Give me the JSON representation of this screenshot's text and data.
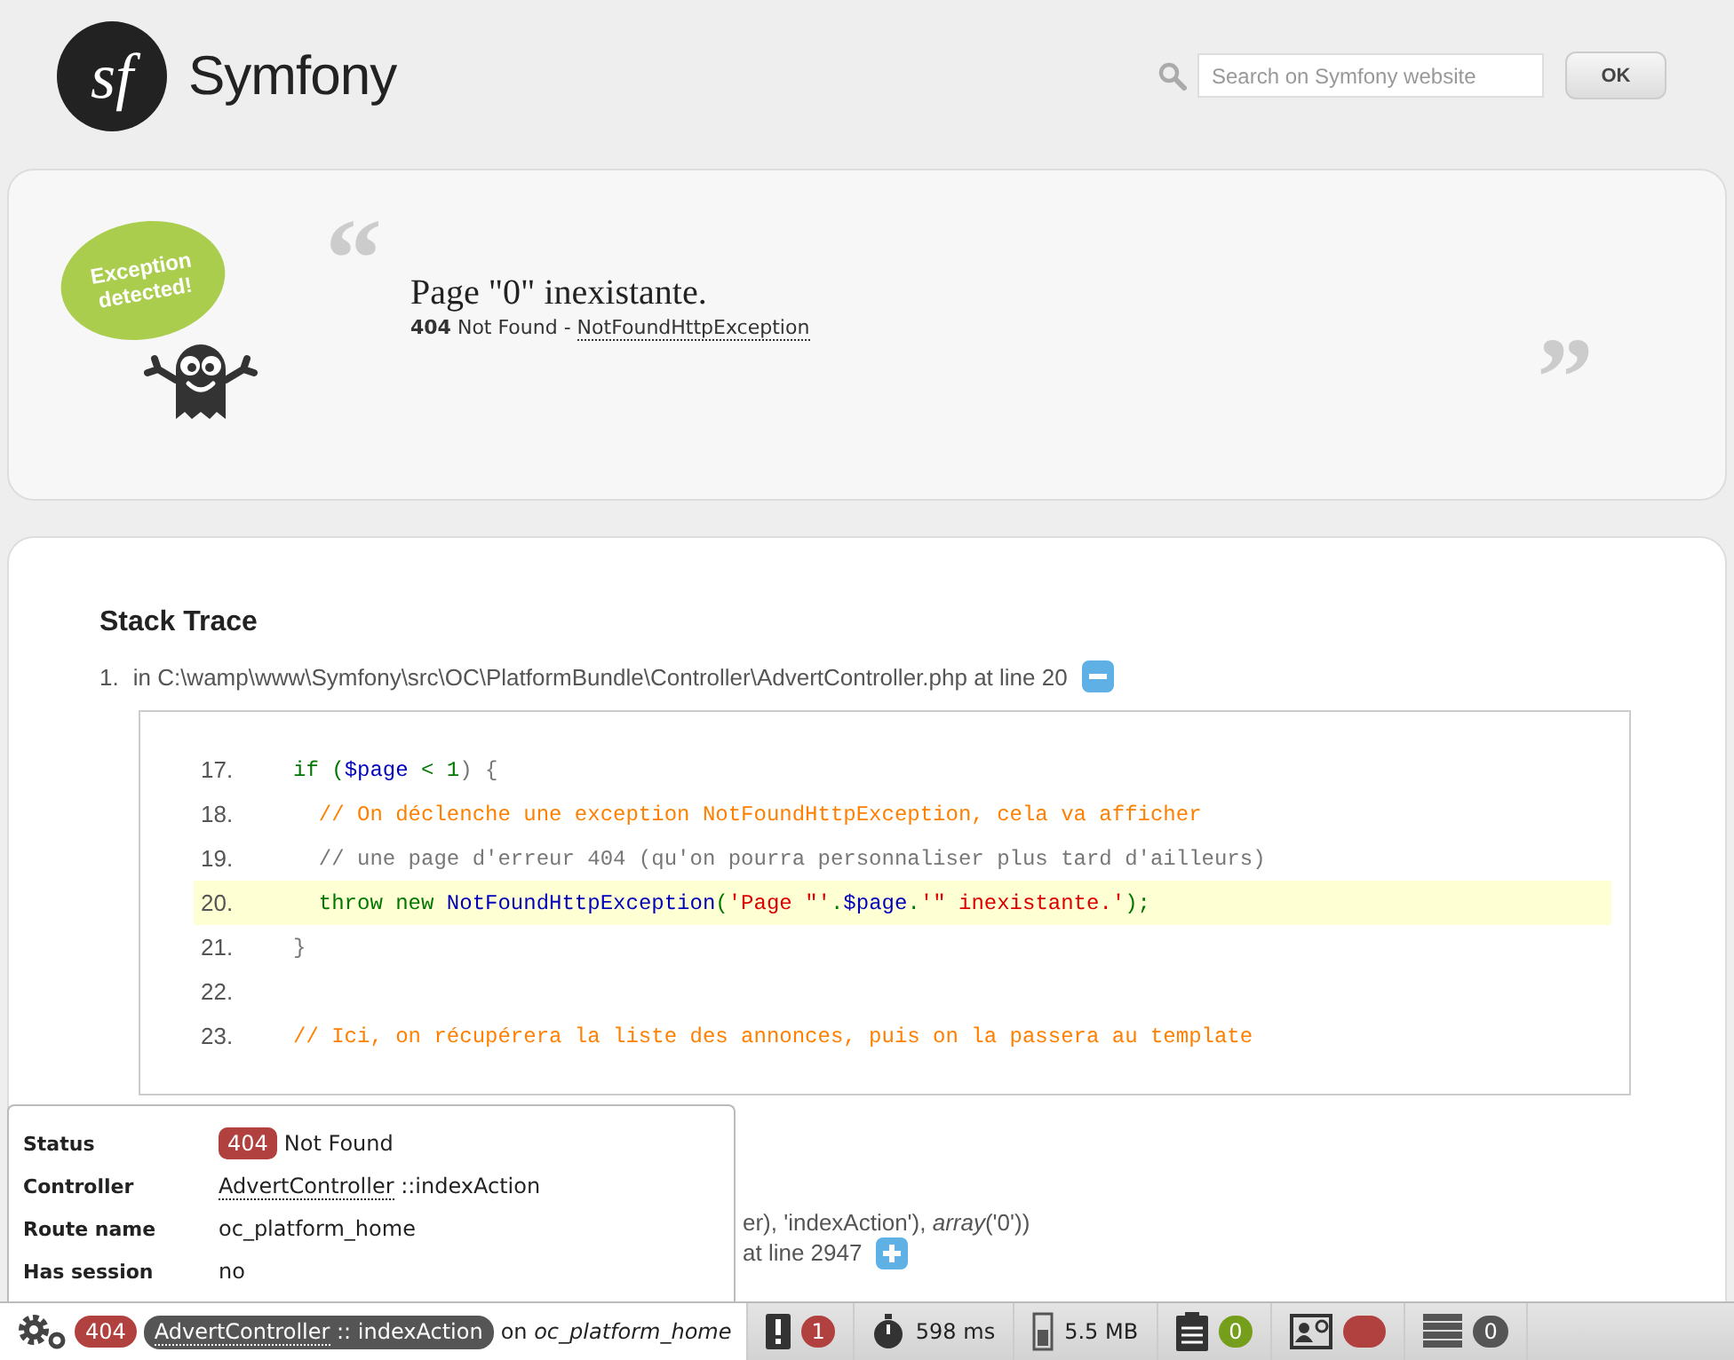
{
  "header": {
    "logo_mark": "sf",
    "brand": "Symfony",
    "search": {
      "placeholder": "Search on Symfony website"
    },
    "ok_button": "OK"
  },
  "exception": {
    "bubble_text": "Exception detected!",
    "open_quote": "“",
    "close_quote": "”",
    "message": "Page \"0\" inexistante.",
    "status_code": "404",
    "status_text": "Not Found - ",
    "exception_class": "NotFoundHttpException"
  },
  "stack_trace": {
    "title": "Stack Trace",
    "items": [
      {
        "number": "1.",
        "location": "in C:\\wamp\\www\\Symfony\\src\\OC\\PlatformBundle\\Controller\\AdvertController.php at line 20",
        "expanded": true,
        "code": [
          {
            "number": "17.",
            "highlighted": false,
            "segments": [
              {
                "kind": "keyword",
                "text": "if ("
              },
              {
                "kind": "variable",
                "text": "$page"
              },
              {
                "kind": "keyword",
                "text": " < 1"
              },
              {
                "kind": "plain",
                "text": ") {"
              }
            ]
          },
          {
            "number": "18.",
            "highlighted": false,
            "segments": [
              {
                "kind": "comment",
                "text": "  // On déclenche une exception NotFoundHttpException, cela va afficher"
              }
            ]
          },
          {
            "number": "19.",
            "highlighted": false,
            "segments": [
              {
                "kind": "plain",
                "text": "  // une page d'erreur 404 (qu'on pourra personnaliser plus tard d'ailleurs)"
              }
            ]
          },
          {
            "number": "20.",
            "highlighted": true,
            "segments": [
              {
                "kind": "keyword",
                "text": "  throw new "
              },
              {
                "kind": "variable",
                "text": "NotFoundHttpException"
              },
              {
                "kind": "keyword",
                "text": "("
              },
              {
                "kind": "string",
                "text": "'Page \"'"
              },
              {
                "kind": "keyword",
                "text": "."
              },
              {
                "kind": "variable",
                "text": "$page"
              },
              {
                "kind": "keyword",
                "text": "."
              },
              {
                "kind": "string",
                "text": "'\" inexistante.'"
              },
              {
                "kind": "keyword",
                "text": ");"
              }
            ]
          },
          {
            "number": "21.",
            "highlighted": false,
            "segments": [
              {
                "kind": "plain",
                "text": "}"
              }
            ]
          },
          {
            "number": "22.",
            "highlighted": false
          },
          {
            "number": "23.",
            "highlighted": false,
            "segments": [
              {
                "kind": "comment",
                "text": "// Ici, on récupérera la liste des annonces, puis on la passera au template"
              }
            ]
          }
        ]
      },
      {
        "lines": [
          "er), 'indexAction'), *array*('0'))",
          "at line 2947"
        ],
        "expanded": false
      }
    ]
  },
  "status_popup": {
    "rows": [
      {
        "kind": "status",
        "label": "Status",
        "badge": "404",
        "value": "Not Found"
      },
      {
        "kind": "controller",
        "label": "Controller",
        "link": "AdvertController",
        "value": " ::indexAction"
      },
      {
        "kind": "text",
        "label": "Route name",
        "value": "oc_platform_home"
      },
      {
        "kind": "text",
        "label": "Has session",
        "value": "no"
      }
    ]
  },
  "toolbar": {
    "status_code": "404",
    "controller": "AdvertController",
    "separator": " :: ",
    "action": "indexAction",
    "on_text": "on",
    "route": "oc_platform_home",
    "panels": [
      {
        "kind": "logger",
        "badge": "1",
        "color": "#b0413e"
      },
      {
        "kind": "time",
        "value": "598 ms"
      },
      {
        "kind": "memory",
        "value": "5.5 MB"
      },
      {
        "kind": "forms",
        "badge": "0",
        "color": "#759e1a"
      },
      {
        "kind": "security",
        "color": "#b0413e"
      },
      {
        "kind": "database",
        "badge": "0",
        "color": "#555555"
      }
    ]
  }
}
